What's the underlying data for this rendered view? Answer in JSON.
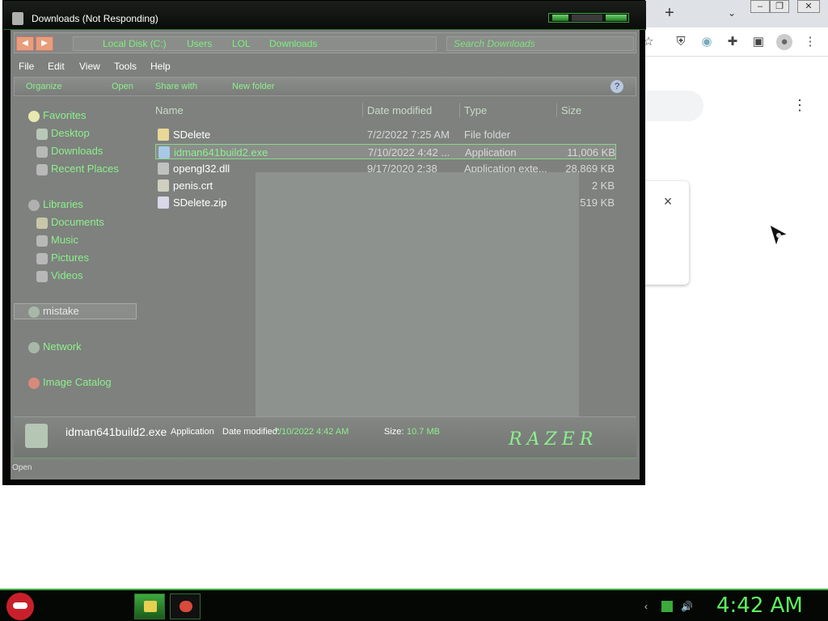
{
  "window": {
    "title": "Downloads (Not Responding)"
  },
  "address": {
    "crumbs": [
      "Local Disk (C:)",
      "Users",
      "LOL",
      "Downloads"
    ],
    "search_placeholder": "Search Downloads"
  },
  "menu": [
    "File",
    "Edit",
    "View",
    "Tools",
    "Help"
  ],
  "commands": {
    "organize": "Organize",
    "open": "Open",
    "share": "Share with",
    "new_folder": "New folder",
    "help": "?"
  },
  "nav": {
    "favorites": "Favorites",
    "desktop": "Desktop",
    "downloads": "Downloads",
    "recent": "Recent Places",
    "libraries": "Libraries",
    "documents": "Documents",
    "music": "Music",
    "pictures": "Pictures",
    "videos": "Videos",
    "homegroup": "mistake",
    "network": "Network",
    "catalog": "Image Catalog"
  },
  "columns": {
    "name": "Name",
    "date": "Date modified",
    "type": "Type",
    "size": "Size"
  },
  "files": [
    {
      "name": "SDelete",
      "date": "7/2/2022 7:25 AM",
      "type": "File folder",
      "size": ""
    },
    {
      "name": "idman641build2.exe",
      "date": "7/10/2022 4:42 ...",
      "type": "Application",
      "size": "11,006 KB"
    },
    {
      "name": "opengl32.dll",
      "date": "9/17/2020 2:38",
      "type": "Application exte...",
      "size": "28,869 KB"
    },
    {
      "name": "penis.crt",
      "date": "",
      "type": "",
      "size": "2 KB"
    },
    {
      "name": "SDelete.zip",
      "date": "",
      "type": "",
      "size": "519 KB"
    }
  ],
  "details": {
    "name": "idman641build2.exe",
    "type": "Application",
    "date_label": "Date modified:",
    "date_value": "7/10/2022 4:42 AM",
    "size_label": "Size:",
    "size_value": "10.7 MB",
    "logo": "RAZER"
  },
  "status": {
    "text": "Open"
  },
  "chrome": {
    "dialog_close": "×"
  },
  "taskbar": {
    "clock": "4:42 AM"
  },
  "colors": {
    "accent": "#5ef05e",
    "link_green": "#8cf08c",
    "pane_gray": "#7e817e"
  }
}
